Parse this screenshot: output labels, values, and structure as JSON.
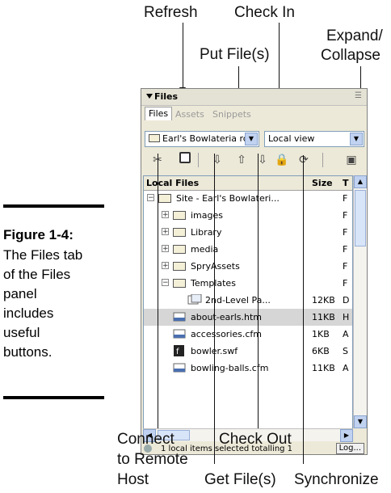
{
  "callouts": {
    "refresh": "Refresh",
    "check_in": "Check In",
    "expand_collapse_1": "Expand/",
    "expand_collapse_2": "Collapse",
    "put_files": "Put File(s)",
    "connect_1": "Connect",
    "connect_2": "to Remote",
    "connect_3": "Host",
    "check_out": "Check Out",
    "get_files": "Get File(s)",
    "synchronize": "Synchronize"
  },
  "figure": {
    "label": "Figure 1-4:",
    "lines": [
      "The Files tab",
      "of the Files",
      "panel",
      "includes",
      "useful",
      "buttons."
    ]
  },
  "panel": {
    "title": "Files",
    "tabs": [
      "Files",
      "Assets",
      "Snippets"
    ],
    "site_select": "Earl's Bowlateria rc",
    "view_select": "Local view",
    "columns": {
      "local": "Local Files",
      "size": "Size",
      "type": "T"
    },
    "rows": [
      {
        "name": "Site - Earl's Bowlateri...",
        "size": "",
        "type": "F"
      },
      {
        "name": "images",
        "size": "",
        "type": "F"
      },
      {
        "name": "Library",
        "size": "",
        "type": "F"
      },
      {
        "name": "media",
        "size": "",
        "type": "F"
      },
      {
        "name": "SpryAssets",
        "size": "",
        "type": "F"
      },
      {
        "name": "Templates",
        "size": "",
        "type": "F"
      },
      {
        "name": "2nd-Level Pa...",
        "size": "12KB",
        "type": "D"
      },
      {
        "name": "about-earls.htm",
        "size": "11KB",
        "type": "H"
      },
      {
        "name": "accessories.cfm",
        "size": "1KB",
        "type": "A"
      },
      {
        "name": "bowler.swf",
        "size": "6KB",
        "type": "S"
      },
      {
        "name": "bowling-balls.cfm",
        "size": "11KB",
        "type": "A"
      }
    ],
    "status": "1 local items selected totalling 1",
    "log_button": "Log..."
  }
}
